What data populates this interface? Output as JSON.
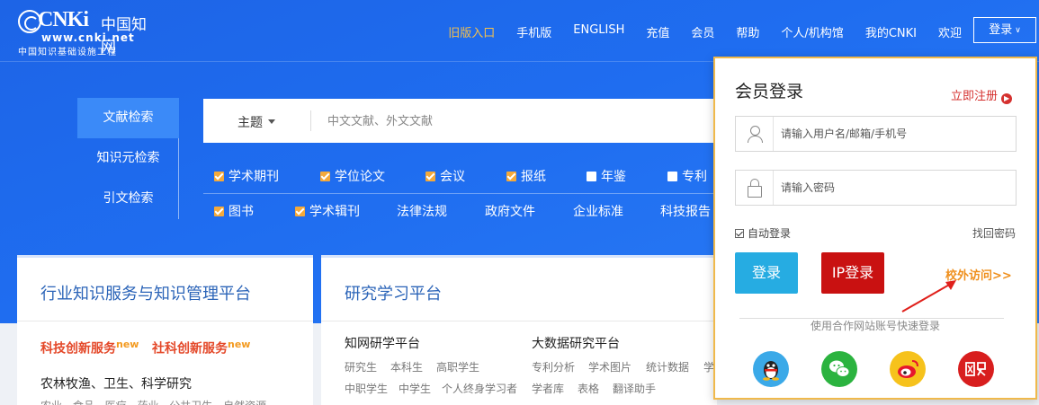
{
  "logo": {
    "brand": "CNKi",
    "brand_cn": "中国知网",
    "url": "www.cnki.net",
    "subtitle": "中国知识基础设施工程"
  },
  "nav": {
    "items": [
      "旧版入口",
      "手机版",
      "ENGLISH",
      "充值",
      "会员",
      "帮助",
      "个人/机构馆",
      "我的CNKI",
      "欢迎"
    ],
    "login": "登录"
  },
  "colors": {
    "hero": "#1f6df0",
    "accent_orange": "#f4a93a",
    "login_blue": "#26ace2",
    "ip_red": "#c91111"
  },
  "search": {
    "tabs": [
      "文献检索",
      "知识元检索",
      "引文检索"
    ],
    "field": "主题",
    "placeholder": "中文文献、外文文献",
    "row1": [
      {
        "label": "学术期刊",
        "checked": true
      },
      {
        "label": "学位论文",
        "checked": true
      },
      {
        "label": "会议",
        "checked": true
      },
      {
        "label": "报纸",
        "checked": true
      },
      {
        "label": "年鉴",
        "checked": false
      },
      {
        "label": "专利",
        "checked": false
      }
    ],
    "row2": [
      {
        "label": "图书",
        "checked": true
      },
      {
        "label": "学术辑刊",
        "checked": true
      },
      {
        "label": "法律法规"
      },
      {
        "label": "政府文件"
      },
      {
        "label": "企业标准"
      },
      {
        "label": "科技报告"
      }
    ]
  },
  "card_left": {
    "title": "行业知识服务与知识管理平台",
    "tag1": "科技创新服务",
    "tag2": "社科创新服务",
    "new": "new",
    "line1": "农林牧渔、卫生、科学研究",
    "line2": "农业 食品 医疗 药业 公共卫生 自然资源"
  },
  "card_mid": {
    "title": "研究学习平台",
    "col1_title": "知网研学平台",
    "col1_row1": [
      "研究生",
      "本科生",
      "高职学生"
    ],
    "col1_row2": [
      "中职学生",
      "中学生",
      "个人终身学习者"
    ],
    "col2_title": "大数据研究平台",
    "col2_row1": [
      "专利分析",
      "学术图片",
      "统计数据",
      "学"
    ],
    "col2_row2": [
      "学者库",
      "表格",
      "翻译助手"
    ]
  },
  "login_panel": {
    "title": "会员登录",
    "register": "立即注册",
    "username_placeholder": "请输入用户名/邮箱/手机号",
    "password_placeholder": "请输入密码",
    "auto_login": "自动登录",
    "forgot": "找回密码",
    "login_button": "登录",
    "ip_login_button": "IP登录",
    "offcampus": "校外访问>>",
    "third_party": "使用合作网站账号快速登录",
    "social": [
      "qq-icon",
      "wechat-icon",
      "weibo-icon",
      "netease-icon"
    ]
  }
}
